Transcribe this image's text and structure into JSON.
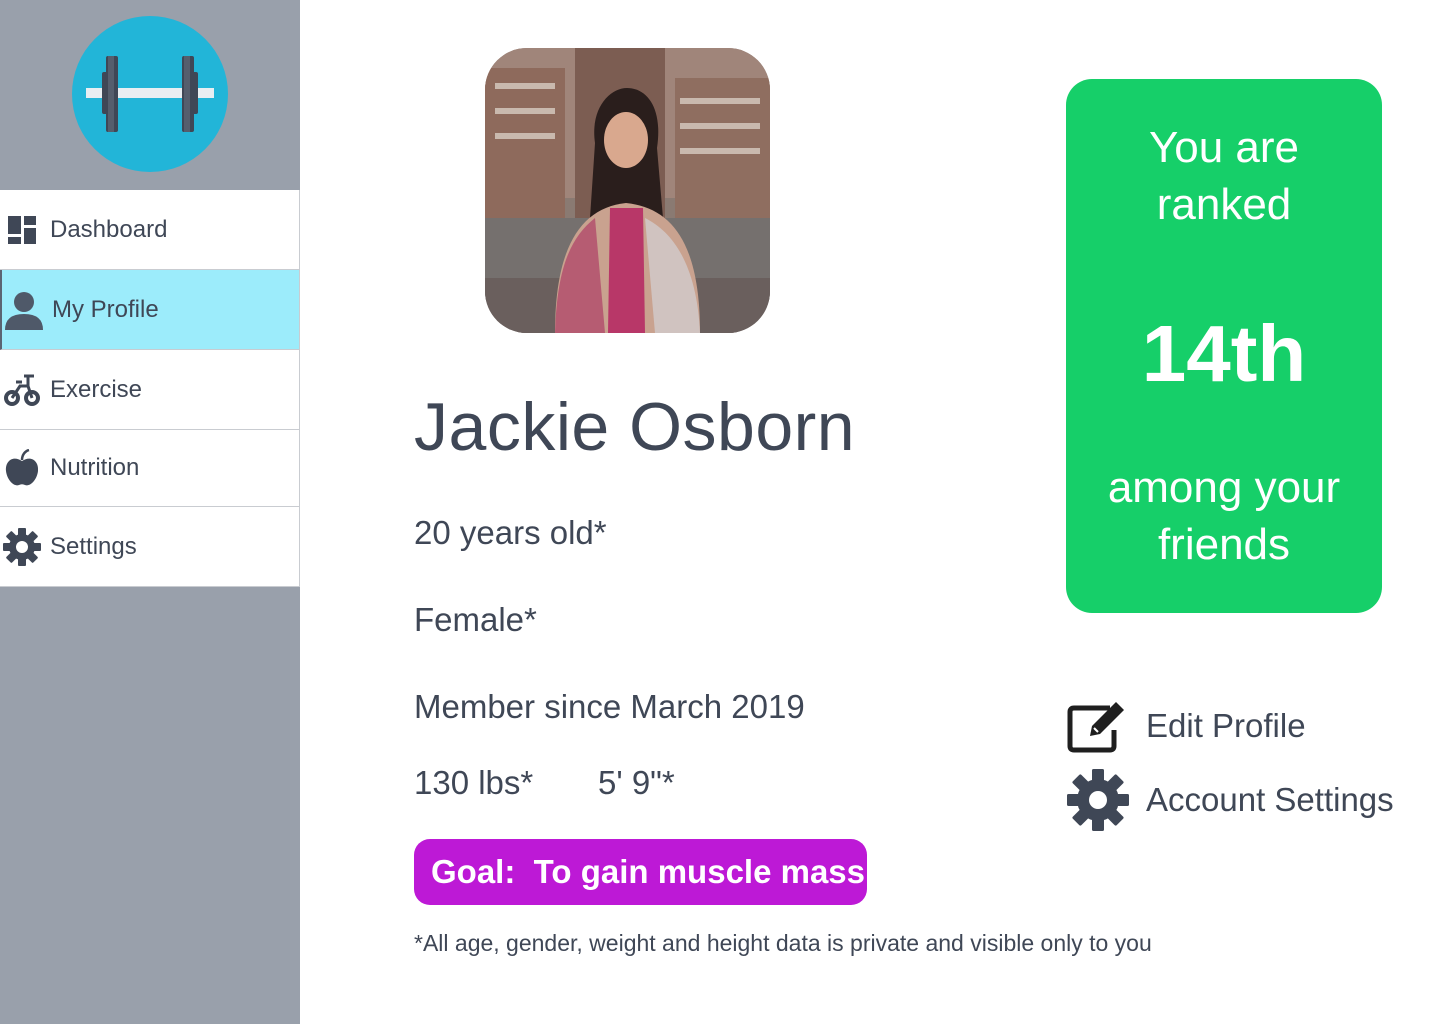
{
  "sidebar": {
    "logo_icon": "dumbbell-icon",
    "items": [
      {
        "label": "Dashboard",
        "icon": "dashboard-icon",
        "active": false
      },
      {
        "label": "My Profile",
        "icon": "user-icon",
        "active": true
      },
      {
        "label": "Exercise",
        "icon": "bike-icon",
        "active": false
      },
      {
        "label": "Nutrition",
        "icon": "apple-icon",
        "active": false
      },
      {
        "label": "Settings",
        "icon": "gear-icon",
        "active": false
      }
    ]
  },
  "profile": {
    "photo": "profile-photo",
    "name": "Jackie Osborn",
    "age": "20 years old*",
    "gender": "Female*",
    "member_since": "Member since March 2019",
    "weight": "130 lbs*",
    "height": "5' 9\"*",
    "goal": "Goal:  To gain muscle mass",
    "footnote": "*All age, gender, weight and height data is private and visible only to you"
  },
  "rank": {
    "line1": "You are",
    "line2": "ranked",
    "value": "14th",
    "line3": "among your",
    "line4": "friends"
  },
  "actions": {
    "edit_profile": "Edit Profile",
    "account_settings": "Account Settings"
  },
  "colors": {
    "sidebar_bg": "#99a0ab",
    "active_nav": "#9cecfb",
    "logo_circle": "#22b5d8",
    "rank_card": "#16cf69",
    "goal_badge": "#bd19d6",
    "text": "#3f4756"
  }
}
